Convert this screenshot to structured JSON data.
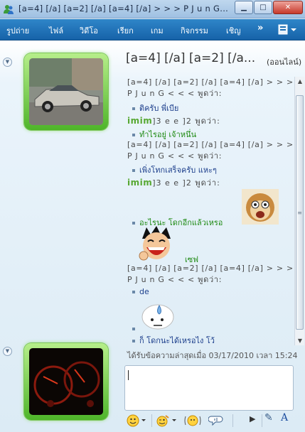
{
  "window": {
    "title": "[a=4] [/a] [a=2] [/a] [a=4] [/a] > > >  P J u n G...",
    "min_glyph": "▁",
    "max_glyph": "□",
    "close_glyph": "✕"
  },
  "menu": {
    "items": [
      "รูปถ่าย",
      "ไฟล์",
      "วิดีโอ",
      "เรียก",
      "เกม",
      "กิจกรรม",
      "เชิญ"
    ],
    "overflow": "»"
  },
  "contact": {
    "name": "[a=4] [/a] [a=2] [/a...",
    "status": "(ออนไลน์)"
  },
  "conversation": {
    "sender_a": "[a=4] [/a] [a=2] [/a] [a=4] [/a] > > > P J u n G  < < < พูดว่า:",
    "sender_b_logo": "imim",
    "sender_b_rest": "]3 e e ]2 พูดว่า:",
    "m1": "ติครับ พี่เบีย",
    "m2": "ทำไรอยู่ เจ้าหนึ่น",
    "m3": "เพิ่งโทกเสร็จครับ แหะๆ",
    "m4": "อะไรนะ โดกอีกแล้วเหรอ",
    "m5": "เซฟ",
    "m6": "de",
    "m7": "ก็ โดกนะได้เหรอไง โว้"
  },
  "footer": {
    "last_received": "ได้รับข้อความล่าสุดเมื่อ 03/17/2010 เวลา 15:24"
  },
  "colors": {
    "menubar": "#1f6fb3",
    "online_frame": "#5fc23a",
    "message_green": "#1f8a13",
    "message_blue": "#1d3f8c"
  },
  "icons": {
    "scroll_up": "▲",
    "scroll_down": "▼",
    "scroll_grip": "≡",
    "collapse": "▼",
    "play": "▶",
    "pen": "✎",
    "text": "A"
  }
}
